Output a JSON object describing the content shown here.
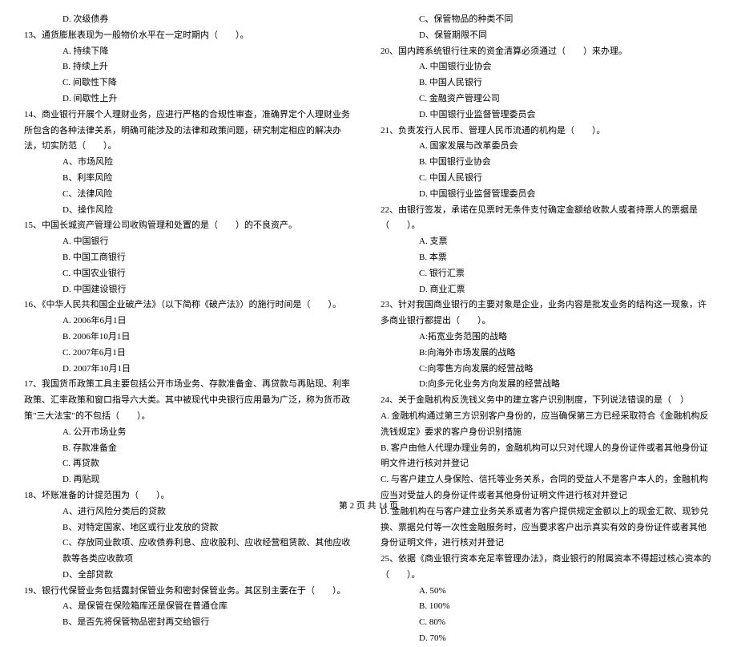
{
  "left": {
    "opt_d_12": "D. 次级债券",
    "q13": "13、通货膨胀表现为一般物价水平在一定时期内（　　）。",
    "q13_a": "A. 持续下降",
    "q13_b": "B. 持续上升",
    "q13_c": "C. 间歇性下降",
    "q13_d": "D. 间歇性上升",
    "q14": "14、商业银行开展个人理财业务，应进行严格的合规性审查，准确界定个人理财业务所包含的各种法律关系，明确可能涉及的法律和政策问题，研究制定相应的解决办法，切实防范（　　）。",
    "q14_a": "A、市场风险",
    "q14_b": "B、利率风险",
    "q14_c": "C、法律风险",
    "q14_d": "D、操作风险",
    "q15": "15、中国长城资产管理公司收购管理和处置的是（　　）的不良资产。",
    "q15_a": "A. 中国银行",
    "q15_b": "B. 中国工商银行",
    "q15_c": "C. 中国农业银行",
    "q15_d": "D. 中国建设银行",
    "q16": "16、《中华人民共和国企业破产法》（以下简称《破产法》）的施行时间是（　　）。",
    "q16_a": "A. 2006年6月1日",
    "q16_b": "B. 2006年10月1日",
    "q16_c": "C. 2007年6月1日",
    "q16_d": "D. 2007年10月1日",
    "q17": "17、我国货币政策工具主要包括公开市场业务、存款准备金、再贷款与再贴现、利率政策、汇率政策和窗口指导六大类。其中被现代中央银行应用最为广泛，称为货币政策\"三大法宝\"的不包括（　　）。",
    "q17_a": "A. 公开市场业务",
    "q17_b": "B. 存款准备金",
    "q17_c": "C. 再贷款",
    "q17_d": "D. 再贴现",
    "q18": "18、坏账准备的计提范围为（　　）。",
    "q18_a": "A、进行风险分类后的贷款",
    "q18_b": "B、对特定国家、地区或行业发放的贷款",
    "q18_c": "C、存放同业款项、应收债券利息、应收股利、应收经营租赁款、其他应收款等各类应收款项",
    "q18_d": "D、全部贷款",
    "q19": "19、银行代保管业务包括露封保管业务和密封保管业务。其区别主要在于（　　）。",
    "q19_a": "A、是保管在保险箱库还是保管在普通仓库",
    "q19_b": "B、是否先将保管物品密封再交给银行"
  },
  "right": {
    "q19_c": "C、保管物品的种类不同",
    "q19_d": "D、保管期限不同",
    "q20": "20、国内跨系统银行往来的资金清算必须通过（　　）来办理。",
    "q20_a": "A. 中国银行业协会",
    "q20_b": "B. 中国人民银行",
    "q20_c": "C. 金融资产管理公司",
    "q20_d": "D. 中国银行业监督管理委员会",
    "q21": "21、负责发行人民币、管理人民币流通的机构是（　　）。",
    "q21_a": "A. 国家发展与改革委员会",
    "q21_b": "B. 中国银行业协会",
    "q21_c": "C. 中国人民银行",
    "q21_d": "D. 中国银行业监督管理委员会",
    "q22": "22、由银行签发，承诺在见票时无条件支付确定金额给收款人或者持票人的票据是（　　）。",
    "q22_a": "A. 支票",
    "q22_b": "B. 本票",
    "q22_c": "C. 银行汇票",
    "q22_d": "D. 商业汇票",
    "q23": "23、针对我国商业银行的主要对象是企业，业务内容是批发业务的结构这一现象，许多商业银行都提出（　　）。",
    "q23_a": "A:拓宽业务范围的战略",
    "q23_b": "B:向海外市场发展的战略",
    "q23_c": "C:向零售方向发展的经营战略",
    "q23_d": "D:向多元化业务方向发展的经营战略",
    "q24": "24、关于金融机构反洗钱义务中的建立客户识别制度，下列说法错误的是（　）",
    "q24_a": "A. 金融机构通过第三方识别客户身份的，应当确保第三方已经采取符合《金融机构反洗钱规定》要求的客户身份识别措施",
    "q24_b": "B. 客户由他人代理办理业务的，金融机构可以只对代理人的身份证件或者其他身份证明文件进行核对并登记",
    "q24_c": "C. 与客户建立人身保险、信托等业务关系，合同的受益人不是客户本人的，金融机构应当对受益人的身份证件或者其他身份证明文件进行核对并登记",
    "q24_d": "D. 金融机构在与客户建立业务关系或者为客户提供规定金额以上的现金汇款、现钞兑换、票据兑付等一次性金融服务时，应当要求客户出示真实有效的身份证件或者其他身份证明文件，进行核对并登记",
    "q25": "25、依据《商业银行资本充足率管理办法》，商业银行的附属资本不得超过核心资本的（　　）。",
    "q25_a": "A. 50%",
    "q25_b": "B. 100%",
    "q25_c": "C. 80%",
    "q25_d": "D. 70%"
  },
  "footer": "第 2 页 共 14 页"
}
